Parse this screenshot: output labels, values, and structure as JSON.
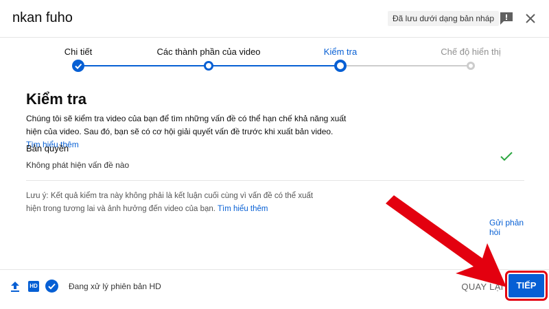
{
  "header": {
    "title": "nkan fuho",
    "draft_status": "Đã lưu dưới dạng bản nháp",
    "icons": {
      "feedback": "feedback-icon",
      "close": "close-icon"
    }
  },
  "stepper": {
    "steps": [
      {
        "label": "Chi tiết",
        "state": "done"
      },
      {
        "label": "Các thành phần của video",
        "state": "done"
      },
      {
        "label": "Kiểm tra",
        "state": "active"
      },
      {
        "label": "Chế độ hiển thị",
        "state": "pending"
      }
    ]
  },
  "main": {
    "heading": "Kiểm tra",
    "description": "Chúng tôi sẽ kiểm tra video của bạn để tìm những vấn đề có thể hạn chế khả năng xuất hiện của video. Sau đó, bạn sẽ có cơ hội giải quyết vấn đề trước khi xuất bản video.",
    "learn_more": "Tìm hiểu thêm",
    "copyright": {
      "title": "Bản quyền",
      "status": "Không phát hiện vấn đề nào"
    },
    "note": "Lưu ý: Kết quả kiểm tra này không phải là kết luận cuối cùng vì vấn đề có thể xuất hiện trong tương lai và ảnh hưởng đến video của bạn.",
    "note_learn_more": "Tìm hiểu thêm",
    "send_feedback": "Gửi phản hồi"
  },
  "footer": {
    "hd_badge": "HD",
    "processing_text": "Đang xử lý phiên bản HD",
    "back_label": "QUAY LẠI",
    "next_label": "TIẾP"
  },
  "colors": {
    "accent": "#065fd4",
    "pending": "#cccccc",
    "success": "#2ba640",
    "annotation": "#e3000f"
  }
}
